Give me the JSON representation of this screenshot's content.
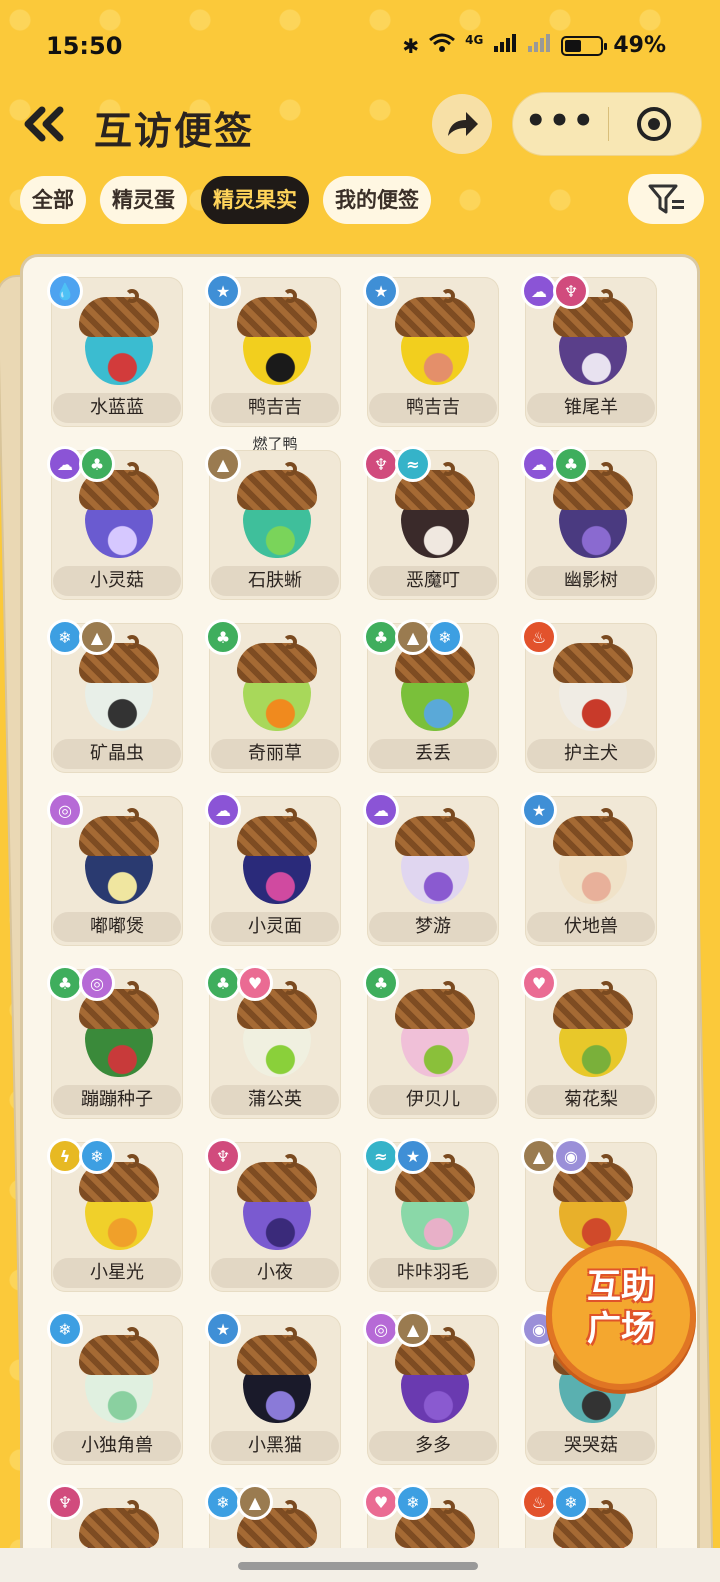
{
  "status": {
    "time": "15:50",
    "network": "4G",
    "battery": "49%"
  },
  "header": {
    "title": "互访便签",
    "back_icon": "double-chevron-left",
    "share_icon": "share-arrow",
    "more_label": "•••"
  },
  "tabs": [
    {
      "label": "全部",
      "active": false
    },
    {
      "label": "精灵蛋",
      "active": false
    },
    {
      "label": "精灵果实",
      "active": true
    },
    {
      "label": "我的便签",
      "active": false
    }
  ],
  "fab": {
    "line1": "互助",
    "line2": "广场"
  },
  "items": [
    {
      "name": "水蓝蓝",
      "badges": [
        "water"
      ],
      "color": "#3bbcd0",
      "accent": "#d23b3b"
    },
    {
      "name": "鸭吉吉",
      "badges": [
        "star"
      ],
      "color": "#f2cf1e",
      "accent": "#1a1a1a",
      "sub": "燃了鸭"
    },
    {
      "name": "鸭吉吉",
      "badges": [
        "star"
      ],
      "color": "#f2cf1e",
      "accent": "#e48f6a"
    },
    {
      "name": "锥尾羊",
      "badges": [
        "ghost",
        "demon"
      ],
      "color": "#5a3f8a",
      "accent": "#e8e2f0"
    },
    {
      "name": "小灵菇",
      "badges": [
        "ghost",
        "grass"
      ],
      "color": "#6a5bd0",
      "accent": "#d6c8ff"
    },
    {
      "name": "石肤蜥",
      "badges": [
        "rock"
      ],
      "color": "#3fbf9b",
      "accent": "#7ad45a"
    },
    {
      "name": "恶魔叮",
      "badges": [
        "demon",
        "wing"
      ],
      "color": "#3a2a2a",
      "accent": "#f0e8e0"
    },
    {
      "name": "幽影树",
      "badges": [
        "ghost",
        "grass"
      ],
      "color": "#4a3a80",
      "accent": "#8a6ad0"
    },
    {
      "name": "矿晶虫",
      "badges": [
        "ice",
        "rock"
      ],
      "color": "#e8efe8",
      "accent": "#333333"
    },
    {
      "name": "奇丽草",
      "badges": [
        "grass"
      ],
      "color": "#a8d85a",
      "accent": "#f08a1e"
    },
    {
      "name": "丢丢",
      "badges": [
        "grass",
        "rock",
        "ice"
      ],
      "color": "#7ac03a",
      "accent": "#5aa9d8"
    },
    {
      "name": "护主犬",
      "badges": [
        "fire"
      ],
      "color": "#f0ece4",
      "accent": "#c83a2a"
    },
    {
      "name": "嘟嘟煲",
      "badges": [
        "bubble"
      ],
      "color": "#2a3a70",
      "accent": "#f0e6a0"
    },
    {
      "name": "小灵面",
      "badges": [
        "ghost"
      ],
      "color": "#2a2a7a",
      "accent": "#d04aa0"
    },
    {
      "name": "梦游",
      "badges": [
        "ghost"
      ],
      "color": "#e0d6f0",
      "accent": "#8a5ad0"
    },
    {
      "name": "伏地兽",
      "badges": [
        "star"
      ],
      "color": "#f0e2c8",
      "accent": "#e8b09a"
    },
    {
      "name": "蹦蹦种子",
      "badges": [
        "grass",
        "bubble"
      ],
      "color": "#3a8a3a",
      "accent": "#c83a3a"
    },
    {
      "name": "蒲公英",
      "badges": [
        "grass",
        "heart"
      ],
      "color": "#f0f0e0",
      "accent": "#8ad03a"
    },
    {
      "name": "伊贝儿",
      "badges": [
        "grass"
      ],
      "color": "#f0c0d8",
      "accent": "#8ac03a"
    },
    {
      "name": "菊花梨",
      "badges": [
        "heart"
      ],
      "color": "#e8c82a",
      "accent": "#7ab03a"
    },
    {
      "name": "小星光",
      "badges": [
        "elec",
        "ice"
      ],
      "color": "#f0d02a",
      "accent": "#f0a02a"
    },
    {
      "name": "小夜",
      "badges": [
        "demon"
      ],
      "color": "#7a5ad0",
      "accent": "#3a2a7a"
    },
    {
      "name": "咔咔羽毛",
      "badges": [
        "wing",
        "star"
      ],
      "color": "#8ad8a8",
      "accent": "#e8b0c8"
    },
    {
      "name": "",
      "badges": [
        "rock",
        "swirl"
      ],
      "color": "#e8b02a",
      "accent": "#d04a2a"
    },
    {
      "name": "小独角兽",
      "badges": [
        "ice"
      ],
      "color": "#e0f0e0",
      "accent": "#8ad0a0"
    },
    {
      "name": "小黑猫",
      "badges": [
        "star"
      ],
      "color": "#1a1a2a",
      "accent": "#8a7ad8"
    },
    {
      "name": "多多",
      "badges": [
        "bubble",
        "rock"
      ],
      "color": "#6a3ab0",
      "accent": "#8a5ad0"
    },
    {
      "name": "哭哭菇",
      "badges": [
        "swirl"
      ],
      "color": "#5ab0b0",
      "accent": "#333333"
    },
    {
      "name": "",
      "badges": [
        "demon"
      ],
      "color": "#5a3a8a",
      "accent": "#e0d0f0"
    },
    {
      "name": "",
      "badges": [
        "ice",
        "rock"
      ],
      "color": "#3a9ad0",
      "accent": "#e0e0e0"
    },
    {
      "name": "",
      "badges": [
        "heart",
        "ice"
      ],
      "color": "#f0c0d8",
      "accent": "#e0e0e0"
    },
    {
      "name": "",
      "badges": [
        "fire",
        "ice"
      ],
      "color": "#e04a3a",
      "accent": "#3a5ad0"
    }
  ]
}
